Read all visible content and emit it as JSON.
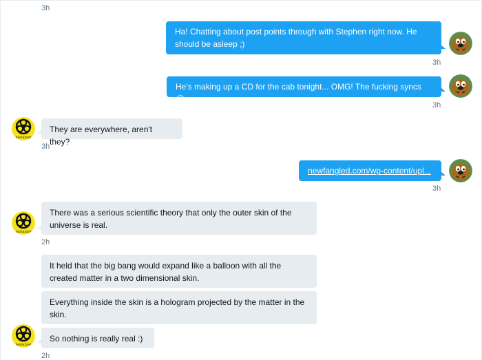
{
  "conversation": {
    "top_time": "3h",
    "messages": [
      {
        "text": "Ha! Chatting about post points through with Stephen right now. He should be asleep ;)",
        "time": "3h"
      },
      {
        "text": "He's making up a CD for the cab tonight... OMG! The fucking syncs 😂",
        "time": "3h"
      },
      {
        "text": "They are everywhere, aren't they?",
        "time": "3h"
      },
      {
        "text": "newfangled.com/wp-content/upl...",
        "time": "3h"
      },
      {
        "text": "There was a serious scientific theory that only the outer skin of the universe is real.",
        "time": "2h"
      },
      {
        "text": "It held that the big bang would expand like a balloon with all the created matter in a two dimensional skin."
      },
      {
        "text": "Everything inside the skin is a hologram projected by the matter in the skin."
      },
      {
        "text": "So nothing is really real  :)",
        "time": "2h"
      }
    ],
    "avatar_text": "biohazard",
    "colors": {
      "sent": "#1da1f2",
      "received": "#e6ecf0",
      "timestamp": "#657786"
    }
  }
}
